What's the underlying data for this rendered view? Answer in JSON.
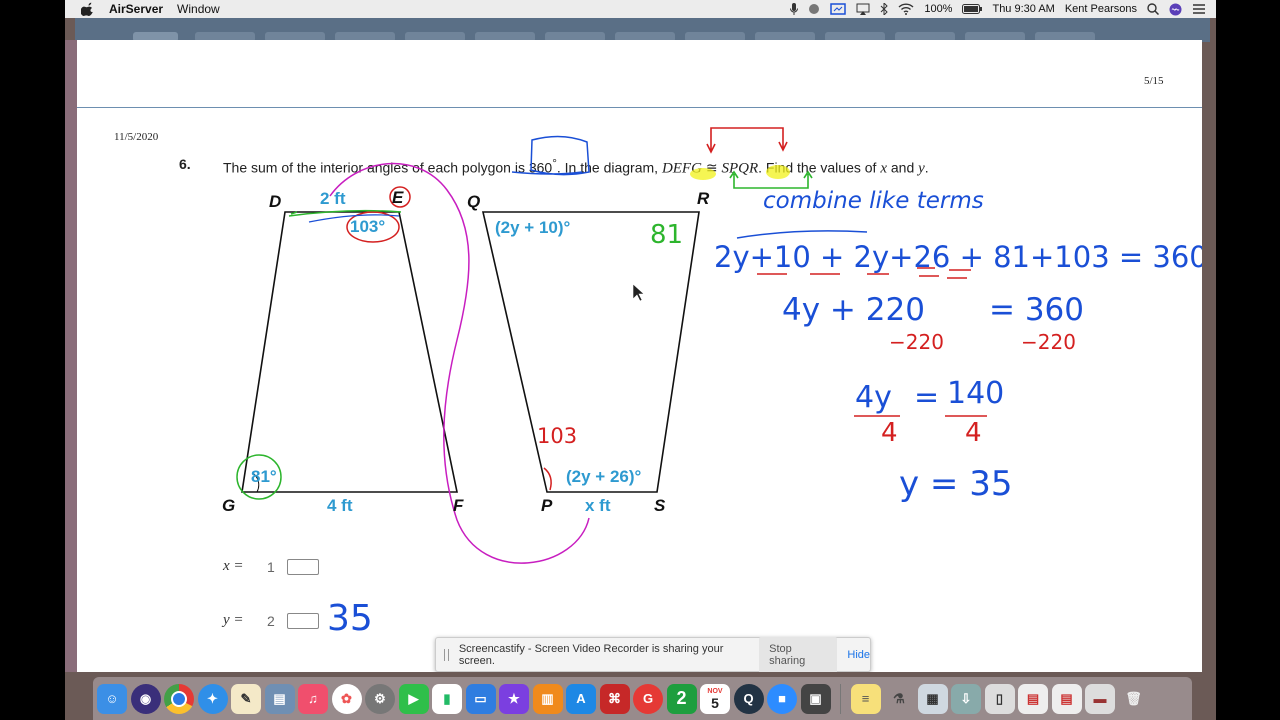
{
  "menubar": {
    "app_name": "AirServer",
    "window_menu": "Window",
    "battery": "100%",
    "clock": "Thu 9:30 AM",
    "user": "Kent Pearsons"
  },
  "document": {
    "page_number": "5/15",
    "date": "11/5/2020",
    "question_number": "6.",
    "question_text_1": "The sum of the interior angles of each polygon is 360",
    "question_degree": "°",
    "question_text_2": ". In the diagram, ",
    "question_math_1": "DEFG",
    "question_congruent": " ≅ ",
    "question_math_2": "SPQR",
    "question_text_3": ". Find the values of ",
    "question_var_x": "x",
    "question_text_4": " and ",
    "question_var_y": "y",
    "question_text_5": "."
  },
  "figure": {
    "left_polygon": {
      "labels": {
        "D": "D",
        "E": "E",
        "F": "F",
        "G": "G"
      },
      "top_side": "2 ft",
      "bottom_side": "4 ft",
      "angle_e": "103°",
      "angle_g": "81°"
    },
    "right_polygon": {
      "labels": {
        "Q": "Q",
        "R": "R",
        "S": "S",
        "P": "P"
      },
      "angle_q": "(2y + 10)°",
      "angle_s": "(2y + 26)°",
      "bottom_side": "x ft"
    }
  },
  "annotations": {
    "note_title": "combine like terms",
    "eq1": "2y+10 + 2y+26 + 81+103 = 360",
    "eq2_left": "4y + 220",
    "eq2_right": "= 360",
    "eq2_sub_left": "−220",
    "eq2_sub_right": "−220",
    "eq3_num_left": "4y",
    "eq3_eq": "=",
    "eq3_num_right": "140",
    "eq3_den_left": "4",
    "eq3_den_right": "4",
    "eq4": "y = 35",
    "angle_r_note": "81",
    "angle_p_note": "103",
    "answer_y_note": "35"
  },
  "answers": {
    "x_label": "x =",
    "x_number": "1",
    "y_label": "y =",
    "y_number": "2"
  },
  "share_banner": {
    "message": "Screencastify - Screen Video Recorder is sharing your screen.",
    "stop_label": "Stop sharing",
    "hide_label": "Hide"
  },
  "dock": {
    "calendar_month": "NOV",
    "calendar_day": "5"
  },
  "colors": {
    "diagram_blue": "#2e9ad0",
    "ink_blue": "#1a4fd6",
    "ink_red": "#d42020",
    "ink_green": "#2db52d",
    "ink_magenta": "#c81ec0",
    "highlight_yellow": "#f2f21a"
  }
}
